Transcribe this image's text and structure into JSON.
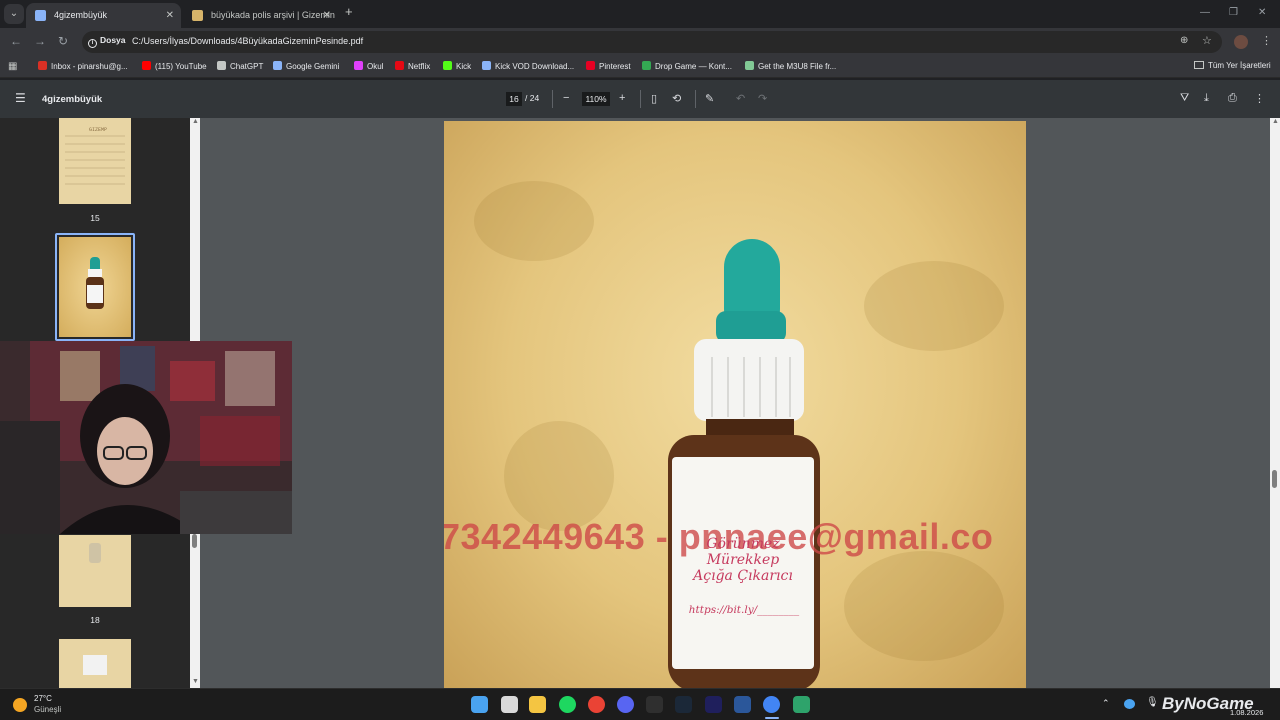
{
  "tabs": [
    {
      "title": "4gizembüyük",
      "active": true
    },
    {
      "title": "büyükada polis arşivi | Gizemin",
      "active": false
    }
  ],
  "address": {
    "chip": "Dosya",
    "url": "C:/Users/İlyas/Downloads/4BüyükadaGizeminPesinde.pdf"
  },
  "bookmarks": [
    {
      "label": "Inbox - pinarshu@g...",
      "color": "#d93025"
    },
    {
      "label": "(115) YouTube",
      "color": "#ff0000"
    },
    {
      "label": "ChatGPT",
      "color": "#c4c7c5"
    },
    {
      "label": "Google Gemini",
      "color": "#8ab4f8"
    },
    {
      "label": "Okul",
      "color": "#e040fb"
    },
    {
      "label": "Netflix",
      "color": "#e50914"
    },
    {
      "label": "Kick",
      "color": "#53fc18"
    },
    {
      "label": "Kick VOD Download...",
      "color": "#8ab4f8"
    },
    {
      "label": "Pinterest",
      "color": "#e60023"
    },
    {
      "label": "Drop Game — Kont...",
      "color": "#34a853"
    },
    {
      "label": "Get the M3U8 File fr...",
      "color": "#81c995"
    }
  ],
  "bookmarks_all": "Tüm Yer İşaretleri",
  "pdf": {
    "title": "4gizembüyük",
    "current_page": "16",
    "total_pages": "/ 24",
    "zoom": "110%"
  },
  "thumbnails": [
    {
      "label": "15"
    },
    {
      "label": ""
    },
    {
      "label": "18"
    },
    {
      "label": ""
    }
  ],
  "page_content": {
    "overlay_text": "7342449643 - pnnaee@gmail.co",
    "bottle_label_lines": [
      "Görünmez",
      "Mürekkep",
      "Açığa Çıkarıcı"
    ],
    "bottle_url": "https://bit.ly/________"
  },
  "taskbar": {
    "weather_temp": "27°C",
    "weather_desc": "Güneşli",
    "watermark": "ByNoGame",
    "clock_date": "1.08.2026"
  }
}
